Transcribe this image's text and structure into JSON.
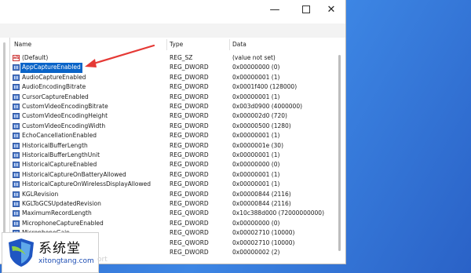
{
  "window": {
    "controls": {
      "minimize": "—",
      "maximize": "",
      "close": "✕"
    }
  },
  "columns": {
    "name": "Name",
    "type": "Type",
    "data": "Data"
  },
  "rows": [
    {
      "name": "(Default)",
      "type": "REG_SZ",
      "data": "(value not set)",
      "icon": "ab-string-icon"
    },
    {
      "name": "AppCaptureEnabled",
      "type": "REG_DWORD",
      "data": "0x00000000 (0)",
      "icon": "binary-value-icon",
      "selected": true
    },
    {
      "name": "AudioCaptureEnabled",
      "type": "REG_DWORD",
      "data": "0x00000001 (1)",
      "icon": "binary-value-icon"
    },
    {
      "name": "AudioEncodingBitrate",
      "type": "REG_DWORD",
      "data": "0x0001f400 (128000)",
      "icon": "binary-value-icon"
    },
    {
      "name": "CursorCaptureEnabled",
      "type": "REG_DWORD",
      "data": "0x00000001 (1)",
      "icon": "binary-value-icon"
    },
    {
      "name": "CustomVideoEncodingBitrate",
      "type": "REG_DWORD",
      "data": "0x003d0900 (4000000)",
      "icon": "binary-value-icon"
    },
    {
      "name": "CustomVideoEncodingHeight",
      "type": "REG_DWORD",
      "data": "0x000002d0 (720)",
      "icon": "binary-value-icon"
    },
    {
      "name": "CustomVideoEncodingWidth",
      "type": "REG_DWORD",
      "data": "0x00000500 (1280)",
      "icon": "binary-value-icon"
    },
    {
      "name": "EchoCancellationEnabled",
      "type": "REG_DWORD",
      "data": "0x00000001 (1)",
      "icon": "binary-value-icon"
    },
    {
      "name": "HistoricalBufferLength",
      "type": "REG_DWORD",
      "data": "0x0000001e (30)",
      "icon": "binary-value-icon"
    },
    {
      "name": "HistoricalBufferLengthUnit",
      "type": "REG_DWORD",
      "data": "0x00000001 (1)",
      "icon": "binary-value-icon"
    },
    {
      "name": "HistoricalCaptureEnabled",
      "type": "REG_DWORD",
      "data": "0x00000000 (0)",
      "icon": "binary-value-icon"
    },
    {
      "name": "HistoricalCaptureOnBatteryAllowed",
      "type": "REG_DWORD",
      "data": "0x00000001 (1)",
      "icon": "binary-value-icon"
    },
    {
      "name": "HistoricalCaptureOnWirelessDisplayAllowed",
      "type": "REG_DWORD",
      "data": "0x00000001 (1)",
      "icon": "binary-value-icon"
    },
    {
      "name": "KGLRevision",
      "type": "REG_DWORD",
      "data": "0x00000844 (2116)",
      "icon": "binary-value-icon"
    },
    {
      "name": "KGLToGCSUpdatedRevision",
      "type": "REG_DWORD",
      "data": "0x00000844 (2116)",
      "icon": "binary-value-icon"
    },
    {
      "name": "MaximumRecordLength",
      "type": "REG_QWORD",
      "data": "0x10c388d000 (72000000000)",
      "icon": "binary-value-icon"
    },
    {
      "name": "MicrophoneCaptureEnabled",
      "type": "REG_DWORD",
      "data": "0x00000000 (0)",
      "icon": "binary-value-icon"
    },
    {
      "name": "MicrophoneGain",
      "type": "REG_QWORD",
      "data": "0x00002710 (10000)",
      "icon": "binary-value-icon"
    },
    {
      "name": "",
      "type": "REG_QWORD",
      "data": "0x00002710 (10000)",
      "icon": "binary-value-icon"
    },
    {
      "name": "",
      "type": "REG_DWORD",
      "data": "0x00000002 (2)",
      "icon": "binary-value-icon"
    }
  ],
  "watermark": {
    "brand_cn": "系统堂",
    "brand_en": "xitongtang.com",
    "faint_text": "ort"
  },
  "colors": {
    "selection": "#0a64c8",
    "annotation_arrow": "#e53935",
    "desktop": "#2b6fcf"
  }
}
